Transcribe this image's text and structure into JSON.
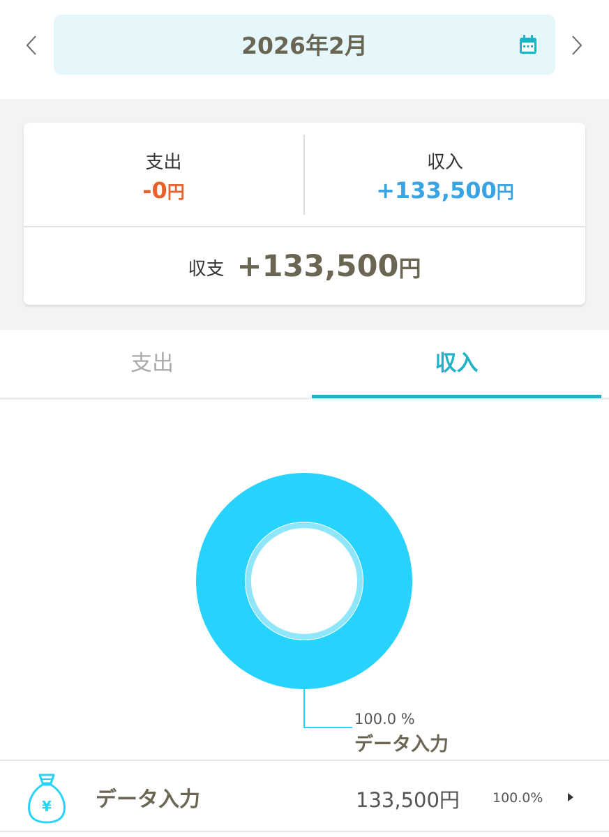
{
  "header": {
    "month": "2026年2月",
    "prev_icon": "chevron-left-icon",
    "next_icon": "chevron-right-icon",
    "calendar_icon": "calendar-icon"
  },
  "summary": {
    "expense_label": "支出",
    "expense_value": "-0",
    "expense_unit": "円",
    "income_label": "収入",
    "income_value": "+133,500",
    "income_unit": "円",
    "balance_label": "収支",
    "balance_value": "+133,500",
    "balance_unit": "円"
  },
  "tabs": [
    {
      "label": "支出",
      "active": false
    },
    {
      "label": "収入",
      "active": true
    }
  ],
  "chart_data": {
    "type": "pie",
    "slices": [
      {
        "label": "データ入力",
        "value": 100.0,
        "pct_text": "100.0 %",
        "color": "#27d3fd"
      }
    ]
  },
  "categories": [
    {
      "name": "データ入力",
      "amount": "133,500円",
      "pct": "100.0%",
      "icon": "money-bag-icon"
    }
  ],
  "colors": {
    "accent": "#1fb2c7",
    "expense": "#e8622d",
    "income": "#3aa3e4",
    "donut": "#27d3fd"
  }
}
